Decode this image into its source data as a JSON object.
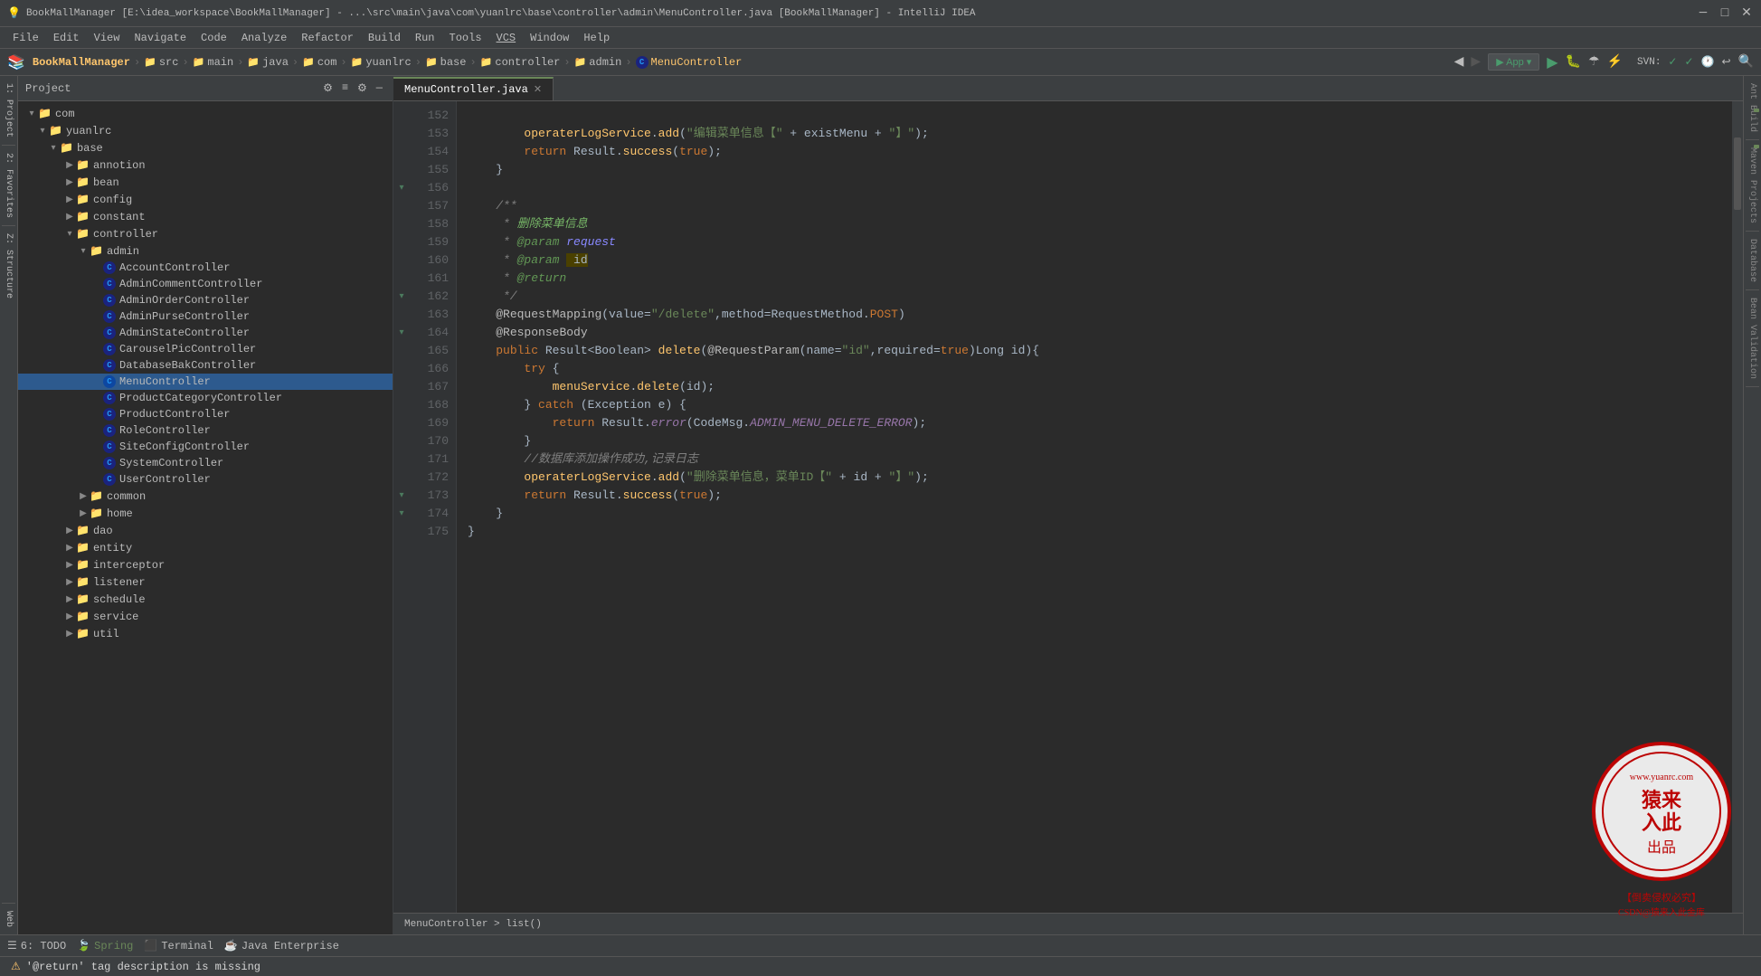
{
  "titlebar": {
    "title": "BookMallManager [E:\\idea_workspace\\BookMallManager] - ...\\src\\main\\java\\com\\yuanlrc\\base\\controller\\admin\\MenuController.java [BookMallManager] - IntelliJ IDEA",
    "logo": "💡"
  },
  "menubar": {
    "items": [
      "File",
      "Edit",
      "View",
      "Navigate",
      "Code",
      "Analyze",
      "Refactor",
      "Build",
      "Run",
      "Tools",
      "VCS",
      "Window",
      "Help"
    ]
  },
  "navbar": {
    "breadcrumb": [
      "BookMallManager",
      "src",
      "main",
      "java",
      "com",
      "yuanlrc",
      "base",
      "controller",
      "admin",
      "MenuController"
    ],
    "app_btn": "App",
    "svn_label": "SVN:"
  },
  "sidebar": {
    "title": "Project",
    "tree": [
      {
        "label": "com",
        "level": 0,
        "type": "folder",
        "expanded": true
      },
      {
        "label": "yuanlrc",
        "level": 1,
        "type": "folder",
        "expanded": true
      },
      {
        "label": "base",
        "level": 2,
        "type": "folder",
        "expanded": true
      },
      {
        "label": "annotion",
        "level": 3,
        "type": "folder",
        "expanded": false
      },
      {
        "label": "bean",
        "level": 3,
        "type": "folder",
        "expanded": false
      },
      {
        "label": "config",
        "level": 3,
        "type": "folder",
        "expanded": false
      },
      {
        "label": "constant",
        "level": 3,
        "type": "folder",
        "expanded": false
      },
      {
        "label": "controller",
        "level": 3,
        "type": "folder",
        "expanded": true
      },
      {
        "label": "admin",
        "level": 4,
        "type": "folder",
        "expanded": true
      },
      {
        "label": "AccountController",
        "level": 5,
        "type": "java-c"
      },
      {
        "label": "AdminCommentController",
        "level": 5,
        "type": "java-c"
      },
      {
        "label": "AdminOrderController",
        "level": 5,
        "type": "java-c"
      },
      {
        "label": "AdminPurseController",
        "level": 5,
        "type": "java-c"
      },
      {
        "label": "AdminStateController",
        "level": 5,
        "type": "java-c"
      },
      {
        "label": "CarouselPicController",
        "level": 5,
        "type": "java-c"
      },
      {
        "label": "DatabaseBakController",
        "level": 5,
        "type": "java-c"
      },
      {
        "label": "MenuController",
        "level": 5,
        "type": "java-c",
        "selected": true
      },
      {
        "label": "ProductCategoryController",
        "level": 5,
        "type": "java-c"
      },
      {
        "label": "ProductController",
        "level": 5,
        "type": "java-c"
      },
      {
        "label": "RoleController",
        "level": 5,
        "type": "java-c"
      },
      {
        "label": "SiteConfigController",
        "level": 5,
        "type": "java-c"
      },
      {
        "label": "SystemController",
        "level": 5,
        "type": "java-c"
      },
      {
        "label": "UserController",
        "level": 5,
        "type": "java-c"
      },
      {
        "label": "common",
        "level": 4,
        "type": "folder",
        "expanded": false
      },
      {
        "label": "home",
        "level": 4,
        "type": "folder",
        "expanded": false
      },
      {
        "label": "dao",
        "level": 3,
        "type": "folder",
        "expanded": false
      },
      {
        "label": "entity",
        "level": 3,
        "type": "folder",
        "expanded": false
      },
      {
        "label": "interceptor",
        "level": 3,
        "type": "folder",
        "expanded": false
      },
      {
        "label": "listener",
        "level": 3,
        "type": "folder",
        "expanded": false
      },
      {
        "label": "schedule",
        "level": 3,
        "type": "folder",
        "expanded": false
      },
      {
        "label": "service",
        "level": 3,
        "type": "folder",
        "expanded": false
      },
      {
        "label": "util",
        "level": 3,
        "type": "folder",
        "expanded": false
      }
    ]
  },
  "editor": {
    "tab_name": "MenuController.java",
    "lines": [
      {
        "num": 152,
        "content": "        operaterLogService.add(\"编辑菜单信息【\" + existMenu + \"】\");"
      },
      {
        "num": 153,
        "content": "        return Result.success(true);"
      },
      {
        "num": 154,
        "content": "    }"
      },
      {
        "num": 155,
        "content": ""
      },
      {
        "num": 156,
        "content": "    /**"
      },
      {
        "num": 157,
        "content": "     * 删除菜单信息"
      },
      {
        "num": 158,
        "content": "     * @param request"
      },
      {
        "num": 159,
        "content": "     * @param id"
      },
      {
        "num": 160,
        "content": "     * @return"
      },
      {
        "num": 161,
        "content": "     */"
      },
      {
        "num": 162,
        "content": "    @RequestMapping(value=\"/delete\",method=RequestMethod.POST)"
      },
      {
        "num": 163,
        "content": "    @ResponseBody"
      },
      {
        "num": 164,
        "content": "    public Result<Boolean> delete(@RequestParam(name=\"id\",required=true)Long id){"
      },
      {
        "num": 165,
        "content": "        try {"
      },
      {
        "num": 166,
        "content": "            menuService.delete(id);"
      },
      {
        "num": 167,
        "content": "        } catch (Exception e) {"
      },
      {
        "num": 168,
        "content": "            return Result.error(CodeMsg.ADMIN_MENU_DELETE_ERROR);"
      },
      {
        "num": 169,
        "content": "        }"
      },
      {
        "num": 170,
        "content": "        //数据库添加操作成功,记录日志"
      },
      {
        "num": 171,
        "content": "        operaterLogService.add(\"删除菜单信息，菜单ID【\" + id + \"】\");"
      },
      {
        "num": 172,
        "content": "        return Result.success(true);"
      },
      {
        "num": 173,
        "content": "    }"
      },
      {
        "num": 174,
        "content": "}"
      },
      {
        "num": 175,
        "content": ""
      }
    ],
    "breadcrumb_bottom": "MenuController > list()"
  },
  "statusbar": {
    "todo": "6: TODO",
    "spring": "Spring",
    "terminal": "Terminal",
    "java_enterprise": "Java Enterprise",
    "warning": "'@return' tag description is missing",
    "warning_icon": "⚠"
  },
  "right_panels": [
    "Ant Build",
    "Maven Projects",
    "Database",
    "Bean Validation"
  ],
  "csdn": {
    "text1": "CSDN",
    "text2": "猿来入此",
    "text3": "出品",
    "url": "www.yuanrc.com"
  }
}
